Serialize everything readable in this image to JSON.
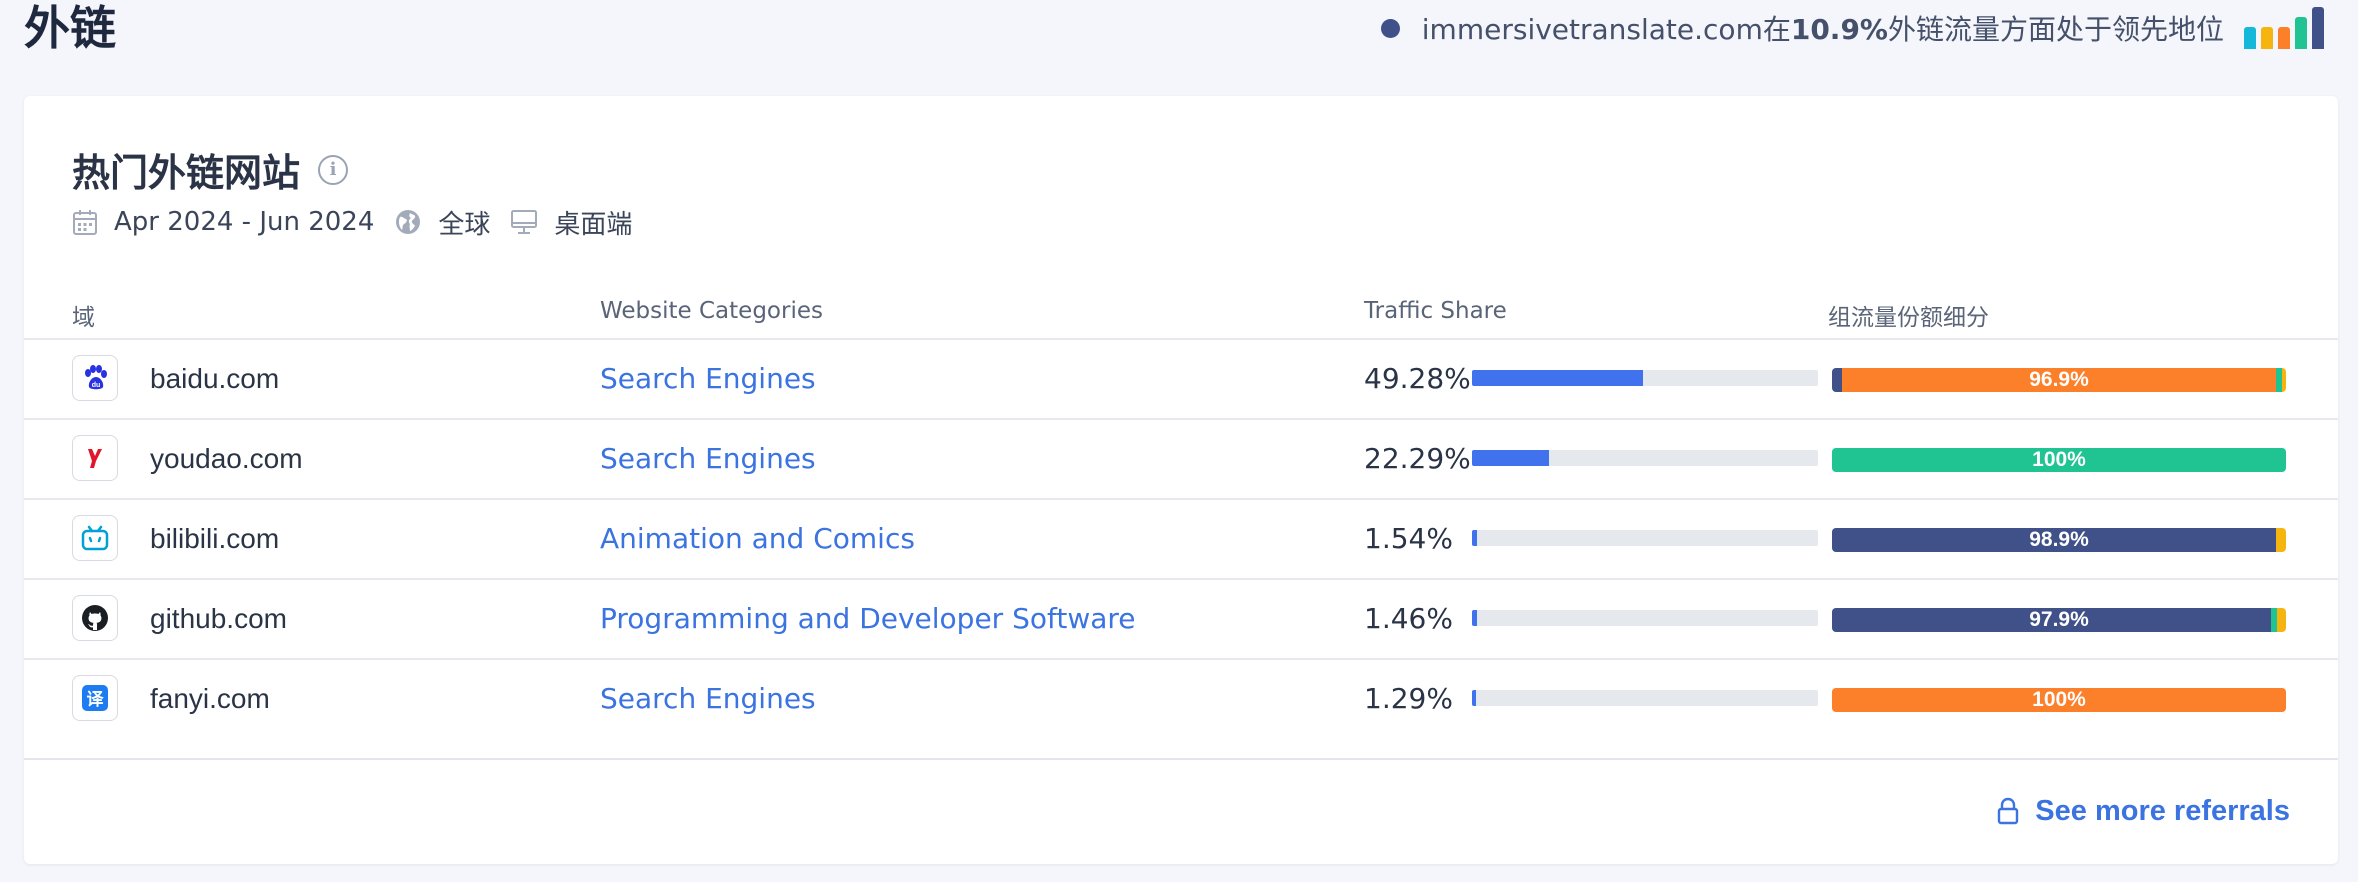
{
  "header": {
    "title": "外链",
    "leader_prefix": "immersivetranslate.com在",
    "leader_pct": "10.9%",
    "leader_suffix": "外链流量方面处于领先地位",
    "leader_icon": "ranking-bars-icon",
    "leader_bar_colors": [
      "#14b8d9",
      "#f5b40f",
      "#fc7f2a",
      "#20c392",
      "#3f5188"
    ]
  },
  "card": {
    "title": "热门外链网站",
    "info_icon": "info-icon",
    "date_range": "Apr 2024 - Jun 2024",
    "region": "全球",
    "device": "桌面端"
  },
  "table": {
    "columns": {
      "domain": "域",
      "category": "Website Categories",
      "share": "Traffic Share",
      "breakdown": "组流量份额细分"
    },
    "rows": [
      {
        "domain": "baidu.com",
        "icon": "baidu-paw-icon",
        "category": "Search Engines",
        "share": "49.28%",
        "share_value": 0.4928,
        "breakdown_label": "96.9%",
        "breakdown": [
          {
            "color": "#3f5188",
            "pct": 2.2
          },
          {
            "color": "#fc7f2a",
            "pct": 95.7
          },
          {
            "color": "#20c392",
            "pct": 1.2
          },
          {
            "color": "#f5b40f",
            "pct": 0.9
          }
        ]
      },
      {
        "domain": "youdao.com",
        "icon": "youdao-y-icon",
        "category": "Search Engines",
        "share": "22.29%",
        "share_value": 0.2229,
        "breakdown_label": "100%",
        "breakdown": [
          {
            "color": "#20c392",
            "pct": 100
          }
        ]
      },
      {
        "domain": "bilibili.com",
        "icon": "bilibili-tv-icon",
        "category": "Animation and Comics",
        "share": "1.54%",
        "share_value": 0.0154,
        "breakdown_label": "98.9%",
        "breakdown": [
          {
            "color": "#3f5188",
            "pct": 97.9
          },
          {
            "color": "#f5b40f",
            "pct": 2.1
          }
        ]
      },
      {
        "domain": "github.com",
        "icon": "github-octocat-icon",
        "category": "Programming and Developer Software",
        "share": "1.46%",
        "share_value": 0.0146,
        "breakdown_label": "97.9%",
        "breakdown": [
          {
            "color": "#3f5188",
            "pct": 96.8
          },
          {
            "color": "#20c392",
            "pct": 1.2
          },
          {
            "color": "#f5b40f",
            "pct": 2.0
          }
        ]
      },
      {
        "domain": "fanyi.com",
        "icon": "fanyi-translate-icon",
        "category": "Search Engines",
        "share": "1.29%",
        "share_value": 0.0129,
        "breakdown_label": "100%",
        "breakdown": [
          {
            "color": "#fc7f2a",
            "pct": 100
          }
        ]
      }
    ]
  },
  "footer": {
    "see_more_label": "See more referrals",
    "see_more_icon": "lock-icon"
  }
}
